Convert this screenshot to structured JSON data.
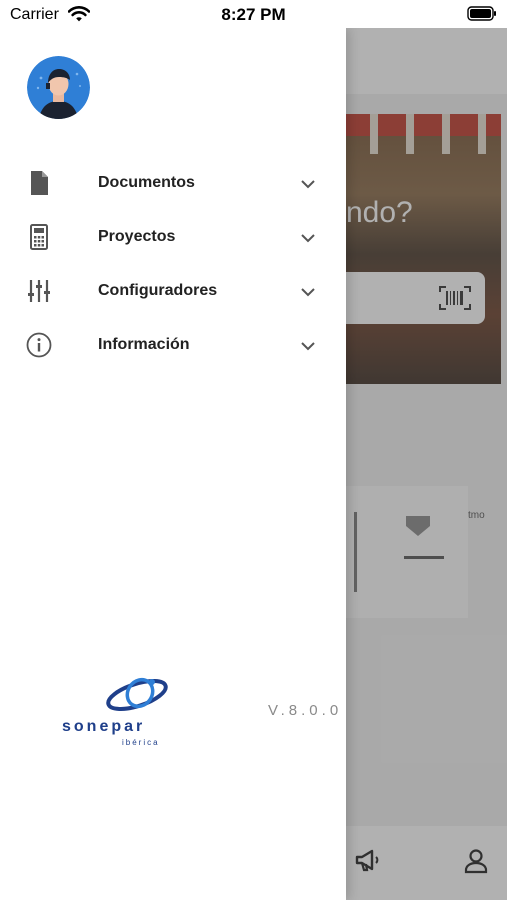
{
  "status_bar": {
    "carrier": "Carrier",
    "time": "8:27 PM"
  },
  "drawer": {
    "avatar_icon": "user-avatar",
    "menu": [
      {
        "label": "Documentos",
        "icon": "document-icon"
      },
      {
        "label": "Proyectos",
        "icon": "calculator-icon"
      },
      {
        "label": "Configuradores",
        "icon": "sliders-icon"
      },
      {
        "label": "Información",
        "icon": "info-icon"
      }
    ],
    "logo": {
      "word": "sonepar",
      "sub": "ibérica"
    },
    "version": "V.8.0.0"
  },
  "background": {
    "headline_fragment": "ndo?",
    "product_text": "tmo"
  },
  "colors": {
    "logo_blue": "#1f3f8a",
    "avatar_blue": "#2f7fd6",
    "dim_overlay": "rgba(70,70,70,0.42)"
  }
}
